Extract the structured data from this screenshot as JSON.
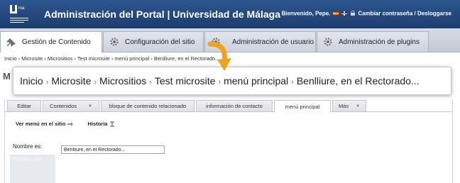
{
  "header": {
    "title": "Administración del Portal | Universidad de Málaga",
    "welcome": "Bienvenido, Pepe.",
    "change_password": "Cambiar contraseña",
    "separator": "/",
    "logout": "Desloggarse",
    "logo_text": "UNIVERSIDAD DE MÁLAGA",
    "colors": {
      "bar": "#1f4478",
      "text": "#ffffff"
    }
  },
  "main_tabs": [
    {
      "label": "Gestión de Contenido",
      "icon": "pin-icon",
      "active": true
    },
    {
      "label": "Configuración del sitio",
      "icon": "gear-icon",
      "active": false
    },
    {
      "label": "Administración de usuario",
      "icon": "gear-icon",
      "active": false
    },
    {
      "label": "Administración de plugins",
      "icon": "gear-icon",
      "active": false
    }
  ],
  "breadcrumb": {
    "items": [
      "Inicio",
      "Microsite",
      "Micrositios",
      "Test microsite",
      "menú principal",
      "Benlliure, en el Rectorado..."
    ],
    "separator": "›"
  },
  "page": {
    "heading_letter": "M"
  },
  "sub_tabs": [
    {
      "label": "Editar",
      "active": false,
      "dropdown": false
    },
    {
      "label": "Contenidos",
      "active": false,
      "dropdown": true
    },
    {
      "label": "bloque de contenido relacionado",
      "active": false,
      "dropdown": false
    },
    {
      "label": "información de contacto",
      "active": false,
      "dropdown": false
    },
    {
      "label": "menú principal",
      "active": true,
      "dropdown": false
    },
    {
      "label": "Más",
      "active": false,
      "dropdown": true
    }
  ],
  "actions": {
    "view_menu": "Ver menú en el sitio",
    "history": "Historia"
  },
  "form": {
    "name_label": "Nombre es:",
    "name_value": "Benlliure, en el Rectorado...",
    "name_label_2": "Nombre en:"
  },
  "accent_color": "#f0a21c"
}
